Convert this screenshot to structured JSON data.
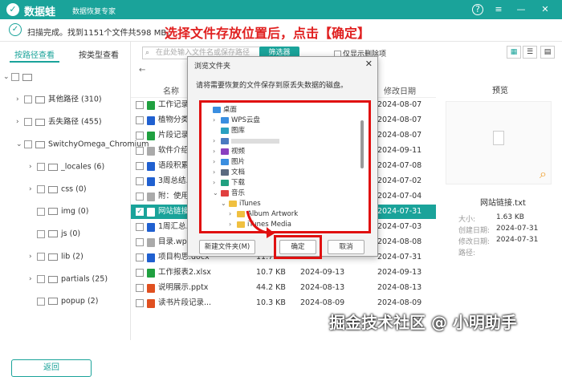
{
  "app": {
    "name": "数据蛙",
    "subtitle": "数据恢复专家",
    "help_icon": "?",
    "menu_icon": "≡",
    "min_icon": "—",
    "close_icon": "✕"
  },
  "status": {
    "text": "扫描完成。找到1151个文件共598 MB。",
    "instruction": "选择文件存放位置后，点击【确定】"
  },
  "left": {
    "tabs": [
      "按路径查看",
      "按类型查看"
    ],
    "tree": [
      {
        "label": "其他路径 (310)",
        "depth": 1
      },
      {
        "label": "丢失路径 (455)",
        "depth": 1
      },
      {
        "label": "SwitchyOmega_Chromium",
        "depth": 1,
        "expanded": true
      },
      {
        "label": "_locales (6)",
        "depth": 2
      },
      {
        "label": "css (0)",
        "depth": 2
      },
      {
        "label": "img (0)",
        "depth": 2
      },
      {
        "label": "js (0)",
        "depth": 2
      },
      {
        "label": "lib (2)",
        "depth": 2
      },
      {
        "label": "partials (25)",
        "depth": 2
      },
      {
        "label": "popup (2)",
        "depth": 2
      }
    ],
    "back_button": "返回"
  },
  "toolbar": {
    "search_placeholder": "在此处输入文件名或保存路径",
    "filter_button": "筛选器",
    "show_deleted": "仅显示删除项"
  },
  "list": {
    "headers": {
      "name": "名称",
      "date": "修改日期"
    },
    "rows": [
      {
        "name": "工作记录表",
        "size": "",
        "type": "",
        "date": "2024-08-07",
        "color": "#20a040"
      },
      {
        "name": "植物分类.c",
        "size": "",
        "type": "",
        "date": "2024-08-07",
        "color": "#2060d0"
      },
      {
        "name": "片段记录.",
        "size": "",
        "type": "",
        "date": "2024-08-07",
        "color": "#20a040"
      },
      {
        "name": "软件介绍 -",
        "size": "",
        "type": "",
        "date": "2024-09-11",
        "color": "#aaaaaa"
      },
      {
        "name": "语段积累.c",
        "size": "",
        "type": "",
        "date": "2024-07-08",
        "color": "#2060d0"
      },
      {
        "name": "3周总结.d",
        "size": "",
        "type": "",
        "date": "2024-07-02",
        "color": "#2060d0"
      },
      {
        "name": "附：使用注",
        "size": "",
        "type": "",
        "date": "2024-07-04",
        "color": "#aaaaaa"
      },
      {
        "name": "网站链接.t",
        "size": "",
        "type": "",
        "date": "2024-07-31",
        "color": "#ffffff",
        "selected": true
      },
      {
        "name": "1周汇总.do",
        "size": "",
        "type": "",
        "date": "2024-07-03",
        "color": "#2060d0"
      },
      {
        "name": "目录.wps",
        "size": "",
        "type": "",
        "date": "2024-08-08",
        "color": "#aaaaaa"
      },
      {
        "name": "项目构思.docx",
        "size": "11.7 KB",
        "type": "",
        "date": "2024-07-31",
        "color": "#2060d0"
      },
      {
        "name": "工作报表2.xlsx",
        "size": "10.7 KB",
        "type": "2024-09-13",
        "date": "2024-09-13",
        "color": "#20a040"
      },
      {
        "name": "说明展示.pptx",
        "size": "44.2 KB",
        "type": "2024-08-13",
        "date": "2024-08-13",
        "color": "#e05020"
      },
      {
        "name": "读书片段记录...",
        "size": "10.3 KB",
        "type": "2024-08-09",
        "date": "2024-08-09",
        "color": "#e05020"
      }
    ]
  },
  "preview": {
    "title": "预览",
    "filename": "网站链接.txt",
    "labels": [
      "大小:",
      "创建日期:",
      "修改日期:",
      "路径:"
    ],
    "values": [
      "1.63 KB",
      "2024-07-31",
      "2024-07-31",
      ""
    ]
  },
  "dialog": {
    "title": "浏览文件夹",
    "message": "请将需要恢复的文件保存到原丢失数据的磁盘。",
    "tree": [
      {
        "label": "桌面",
        "depth": 0,
        "color": "#3a8ee0"
      },
      {
        "label": "WPS云盘",
        "depth": 1,
        "color": "#3a8ee0",
        "arrow": "›"
      },
      {
        "label": "图库",
        "depth": 1,
        "color": "#2aa0c0",
        "arrow": ""
      },
      {
        "label": "",
        "depth": 1,
        "color": "#4a7ac0",
        "arrow": "›"
      },
      {
        "label": "视频",
        "depth": 1,
        "color": "#8a40c0",
        "arrow": "›"
      },
      {
        "label": "图片",
        "depth": 1,
        "color": "#3a8ee0",
        "arrow": "›"
      },
      {
        "label": "文档",
        "depth": 1,
        "color": "#5a6a80",
        "arrow": "›"
      },
      {
        "label": "下载",
        "depth": 1,
        "color": "#20a080",
        "arrow": "›"
      },
      {
        "label": "音乐",
        "depth": 1,
        "color": "#e04040",
        "arrow": "⌄"
      },
      {
        "label": "iTunes",
        "depth": 2,
        "color": "#f0c040",
        "arrow": "⌄"
      },
      {
        "label": "Album Artwork",
        "depth": 3,
        "color": "#f0c040",
        "arrow": "›"
      },
      {
        "label": "iTunes Media",
        "depth": 3,
        "color": "#f0c040",
        "arrow": "›"
      }
    ],
    "new_folder": "新建文件夹(M)",
    "ok": "确定",
    "cancel": "取消"
  },
  "watermark": "掘金技术社区 @ 小明助手"
}
